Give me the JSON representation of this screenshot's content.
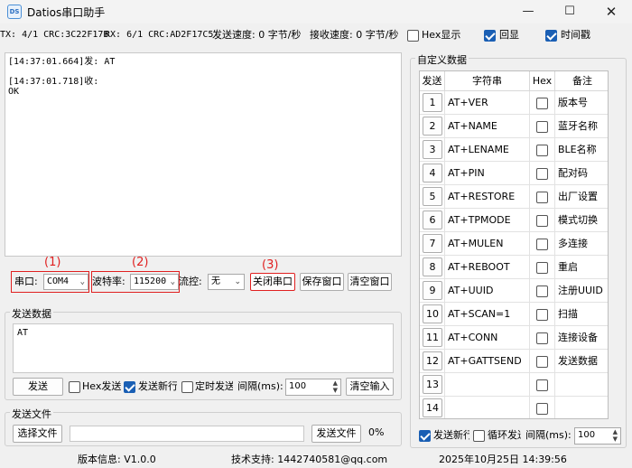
{
  "window": {
    "title": "Datios串口助手",
    "icon_text": "DS"
  },
  "status": {
    "tx": "TX: 4/1 CRC:3C22F17B",
    "rx": "RX: 6/1 CRC:AD2F17C5",
    "send_speed": "发送速度: 0 字节/秒",
    "recv_speed": "接收速度: 0 字节/秒",
    "hex_display": {
      "label": "Hex显示",
      "checked": false
    },
    "echo": {
      "label": "回显",
      "checked": true
    },
    "timestamp": {
      "label": "时间戳",
      "checked": true
    }
  },
  "receive": {
    "text": "[14:37:01.664]发: AT\n\n[14:37:01.718]收:\nOK"
  },
  "port_bar": {
    "port_label": "串口:",
    "port_value": "COM4",
    "baud_label": "波特率:",
    "baud_value": "115200",
    "flow_label": "流控:",
    "flow_value": "无",
    "close_port": "关闭串口",
    "save_window": "保存窗口",
    "clear_window": "清空窗口",
    "markers": [
      "(1)",
      "(2)",
      "(3)"
    ]
  },
  "send_group": {
    "title": "发送数据",
    "text": "AT",
    "send": "发送",
    "hex_send": {
      "label": "Hex发送",
      "checked": false
    },
    "send_newline": {
      "label": "发送新行",
      "checked": true
    },
    "timed_send": {
      "label": "定时发送",
      "checked": false
    },
    "interval_label": "间隔(ms):",
    "interval_value": "100",
    "clear_input": "清空输入"
  },
  "file_group": {
    "title": "发送文件",
    "choose_file": "选择文件",
    "send_file": "发送文件",
    "progress": "0%"
  },
  "custom": {
    "title": "自定义数据",
    "headers": [
      "发送",
      "字符串",
      "Hex",
      "备注"
    ],
    "rows": [
      {
        "idx": "1",
        "cmd": "AT+VER",
        "note": "版本号"
      },
      {
        "idx": "2",
        "cmd": "AT+NAME",
        "note": "蓝牙名称"
      },
      {
        "idx": "3",
        "cmd": "AT+LENAME",
        "note": "BLE名称"
      },
      {
        "idx": "4",
        "cmd": "AT+PIN",
        "note": "配对码"
      },
      {
        "idx": "5",
        "cmd": "AT+RESTORE",
        "note": "出厂设置"
      },
      {
        "idx": "6",
        "cmd": "AT+TPMODE",
        "note": "模式切换"
      },
      {
        "idx": "7",
        "cmd": "AT+MULEN",
        "note": "多连接"
      },
      {
        "idx": "8",
        "cmd": "AT+REBOOT",
        "note": "重启"
      },
      {
        "idx": "9",
        "cmd": "AT+UUID",
        "note": "注册UUID"
      },
      {
        "idx": "10",
        "cmd": "AT+SCAN=1",
        "note": "扫描"
      },
      {
        "idx": "11",
        "cmd": "AT+CONN",
        "note": "连接设备"
      },
      {
        "idx": "12",
        "cmd": "AT+GATTSEND",
        "note": "发送数据"
      },
      {
        "idx": "13",
        "cmd": "",
        "note": ""
      },
      {
        "idx": "14",
        "cmd": "",
        "note": ""
      }
    ],
    "send_newline": {
      "label": "发送新行",
      "checked": true
    },
    "loop_send": {
      "label": "循环发送",
      "checked": false
    },
    "interval_label": "间隔(ms):",
    "interval_value": "100"
  },
  "footer": {
    "version": "版本信息: V1.0.0",
    "support": "技术支持: 1442740581@qq.com",
    "datetime": "2025年10月25日  14:39:56"
  }
}
